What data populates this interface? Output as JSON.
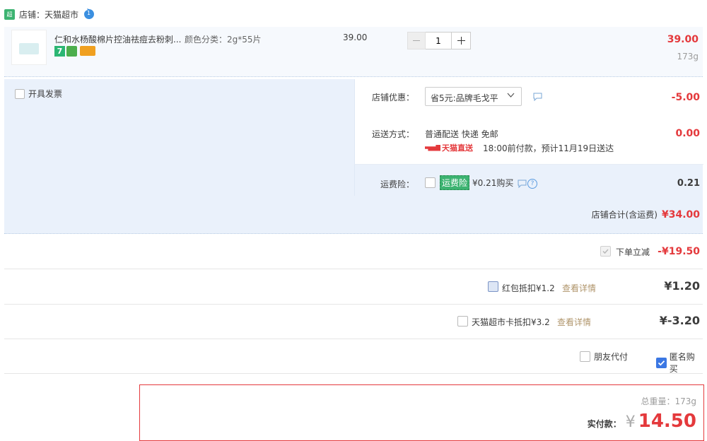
{
  "shop": {
    "label": "店铺：天猫超市",
    "badge_text": "超市",
    "wangwang_badge": "1"
  },
  "item": {
    "title": "仁和水杨酸棉片控油祛痘去粉刺...",
    "sku": "颜色分类：2g*55片",
    "unit_price": "39.00",
    "quantity": "1",
    "subtotal": "39.00",
    "weight": "173g",
    "tag_7": "7"
  },
  "invoice": {
    "label": "开具发票"
  },
  "shop_discount": {
    "label": "店铺优惠：",
    "selected": "省5元:品牌毛戈平",
    "amount": "-5.00"
  },
  "shipping": {
    "label": "运送方式：",
    "method": "普通配送 快递 免邮",
    "amount": "0.00",
    "badge": "天猫直送",
    "note": "18:00前付款，预计11月19日送达"
  },
  "insurance": {
    "label": "运费险：",
    "tag": "运费险",
    "price_text": "¥0.21购买",
    "amount": "0.21"
  },
  "shop_total": {
    "label": "店铺合计(含运费)",
    "amount": "¥34.00"
  },
  "instant_discount": {
    "label": "下单立减",
    "amount": "-¥19.50"
  },
  "red_packet": {
    "label": "红包抵扣¥1.2",
    "details": "查看详情",
    "amount": "¥1.20"
  },
  "market_card": {
    "label": "天猫超市卡抵扣¥3.2",
    "details": "查看详情",
    "amount": "¥-3.20"
  },
  "friend_pay": {
    "label": "朋友代付"
  },
  "anonymous": {
    "label": "匿名购买"
  },
  "summary": {
    "weight_label": "总重量：",
    "weight_value": "173g",
    "pay_label": "实付款：",
    "currency": "¥",
    "pay_amount": "14.50"
  },
  "colors": {
    "accent_red": "#e4393c",
    "panel_blue": "#eaf1fb",
    "tmall_green": "#3cb371",
    "check_blue": "#3b77e3"
  },
  "icons": [
    "tmall-market-icon",
    "wangwang-icon",
    "minus-icon",
    "plus-icon",
    "chevron-down-icon",
    "message-icon",
    "help-icon",
    "checkmark-icon"
  ]
}
